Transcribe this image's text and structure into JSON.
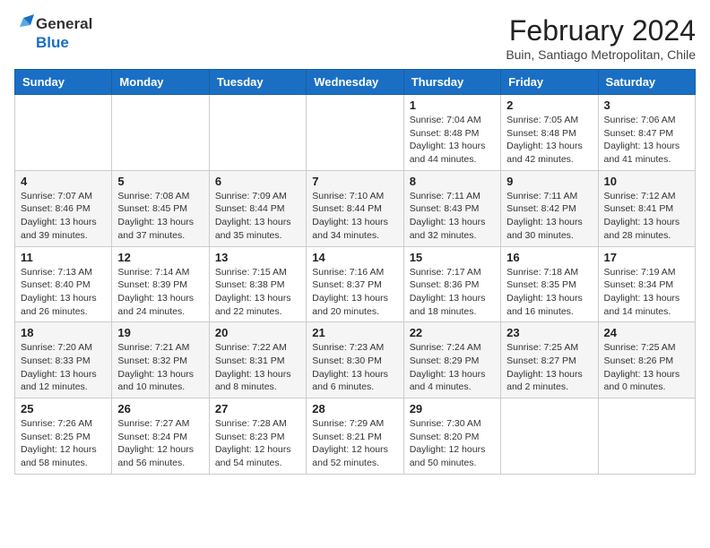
{
  "logo": {
    "general": "General",
    "blue": "Blue"
  },
  "title": "February 2024",
  "subtitle": "Buin, Santiago Metropolitan, Chile",
  "days_of_week": [
    "Sunday",
    "Monday",
    "Tuesday",
    "Wednesday",
    "Thursday",
    "Friday",
    "Saturday"
  ],
  "weeks": [
    [
      {
        "day": "",
        "info": ""
      },
      {
        "day": "",
        "info": ""
      },
      {
        "day": "",
        "info": ""
      },
      {
        "day": "",
        "info": ""
      },
      {
        "day": "1",
        "info": "Sunrise: 7:04 AM\nSunset: 8:48 PM\nDaylight: 13 hours and 44 minutes."
      },
      {
        "day": "2",
        "info": "Sunrise: 7:05 AM\nSunset: 8:48 PM\nDaylight: 13 hours and 42 minutes."
      },
      {
        "day": "3",
        "info": "Sunrise: 7:06 AM\nSunset: 8:47 PM\nDaylight: 13 hours and 41 minutes."
      }
    ],
    [
      {
        "day": "4",
        "info": "Sunrise: 7:07 AM\nSunset: 8:46 PM\nDaylight: 13 hours and 39 minutes."
      },
      {
        "day": "5",
        "info": "Sunrise: 7:08 AM\nSunset: 8:45 PM\nDaylight: 13 hours and 37 minutes."
      },
      {
        "day": "6",
        "info": "Sunrise: 7:09 AM\nSunset: 8:44 PM\nDaylight: 13 hours and 35 minutes."
      },
      {
        "day": "7",
        "info": "Sunrise: 7:10 AM\nSunset: 8:44 PM\nDaylight: 13 hours and 34 minutes."
      },
      {
        "day": "8",
        "info": "Sunrise: 7:11 AM\nSunset: 8:43 PM\nDaylight: 13 hours and 32 minutes."
      },
      {
        "day": "9",
        "info": "Sunrise: 7:11 AM\nSunset: 8:42 PM\nDaylight: 13 hours and 30 minutes."
      },
      {
        "day": "10",
        "info": "Sunrise: 7:12 AM\nSunset: 8:41 PM\nDaylight: 13 hours and 28 minutes."
      }
    ],
    [
      {
        "day": "11",
        "info": "Sunrise: 7:13 AM\nSunset: 8:40 PM\nDaylight: 13 hours and 26 minutes."
      },
      {
        "day": "12",
        "info": "Sunrise: 7:14 AM\nSunset: 8:39 PM\nDaylight: 13 hours and 24 minutes."
      },
      {
        "day": "13",
        "info": "Sunrise: 7:15 AM\nSunset: 8:38 PM\nDaylight: 13 hours and 22 minutes."
      },
      {
        "day": "14",
        "info": "Sunrise: 7:16 AM\nSunset: 8:37 PM\nDaylight: 13 hours and 20 minutes."
      },
      {
        "day": "15",
        "info": "Sunrise: 7:17 AM\nSunset: 8:36 PM\nDaylight: 13 hours and 18 minutes."
      },
      {
        "day": "16",
        "info": "Sunrise: 7:18 AM\nSunset: 8:35 PM\nDaylight: 13 hours and 16 minutes."
      },
      {
        "day": "17",
        "info": "Sunrise: 7:19 AM\nSunset: 8:34 PM\nDaylight: 13 hours and 14 minutes."
      }
    ],
    [
      {
        "day": "18",
        "info": "Sunrise: 7:20 AM\nSunset: 8:33 PM\nDaylight: 13 hours and 12 minutes."
      },
      {
        "day": "19",
        "info": "Sunrise: 7:21 AM\nSunset: 8:32 PM\nDaylight: 13 hours and 10 minutes."
      },
      {
        "day": "20",
        "info": "Sunrise: 7:22 AM\nSunset: 8:31 PM\nDaylight: 13 hours and 8 minutes."
      },
      {
        "day": "21",
        "info": "Sunrise: 7:23 AM\nSunset: 8:30 PM\nDaylight: 13 hours and 6 minutes."
      },
      {
        "day": "22",
        "info": "Sunrise: 7:24 AM\nSunset: 8:29 PM\nDaylight: 13 hours and 4 minutes."
      },
      {
        "day": "23",
        "info": "Sunrise: 7:25 AM\nSunset: 8:27 PM\nDaylight: 13 hours and 2 minutes."
      },
      {
        "day": "24",
        "info": "Sunrise: 7:25 AM\nSunset: 8:26 PM\nDaylight: 13 hours and 0 minutes."
      }
    ],
    [
      {
        "day": "25",
        "info": "Sunrise: 7:26 AM\nSunset: 8:25 PM\nDaylight: 12 hours and 58 minutes."
      },
      {
        "day": "26",
        "info": "Sunrise: 7:27 AM\nSunset: 8:24 PM\nDaylight: 12 hours and 56 minutes."
      },
      {
        "day": "27",
        "info": "Sunrise: 7:28 AM\nSunset: 8:23 PM\nDaylight: 12 hours and 54 minutes."
      },
      {
        "day": "28",
        "info": "Sunrise: 7:29 AM\nSunset: 8:21 PM\nDaylight: 12 hours and 52 minutes."
      },
      {
        "day": "29",
        "info": "Sunrise: 7:30 AM\nSunset: 8:20 PM\nDaylight: 12 hours and 50 minutes."
      },
      {
        "day": "",
        "info": ""
      },
      {
        "day": "",
        "info": ""
      }
    ]
  ]
}
